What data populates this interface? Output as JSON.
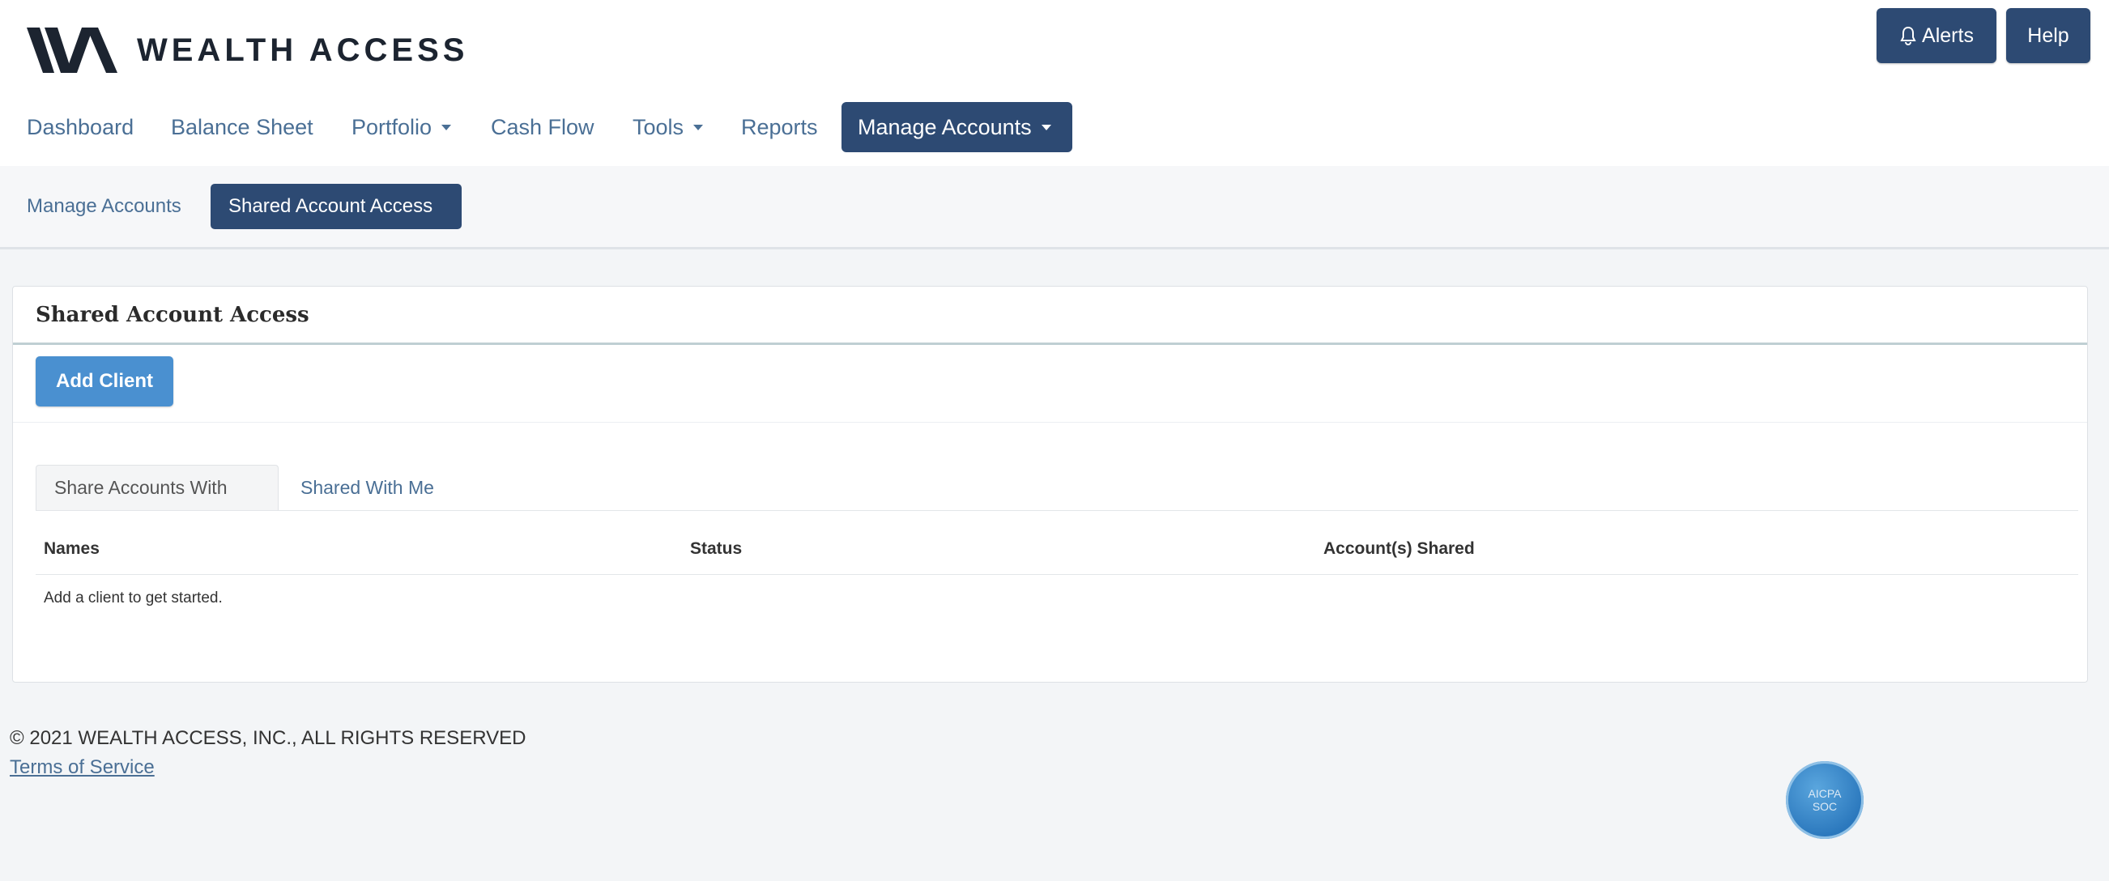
{
  "brand": {
    "name": "WEALTH ACCESS",
    "logo_icon": "wa-logo-icon"
  },
  "header_buttons": {
    "alerts_label": "Alerts",
    "alerts_icon": "bell-icon",
    "help_label": "Help"
  },
  "main_nav": {
    "items": [
      {
        "label": "Dashboard"
      },
      {
        "label": "Balance Sheet"
      },
      {
        "label": "Portfolio"
      },
      {
        "label": "Cash Flow"
      },
      {
        "label": "Tools"
      },
      {
        "label": "Reports"
      },
      {
        "label": "Manage Accounts"
      }
    ],
    "active": "Manage Accounts"
  },
  "sub_nav": {
    "items": [
      {
        "label": "Manage Accounts"
      },
      {
        "label": "Shared Account Access"
      }
    ],
    "active": "Shared Account Access"
  },
  "panel": {
    "title": "Shared Account Access",
    "add_client_label": "Add Client",
    "tabs": [
      {
        "label": "Share Accounts With"
      },
      {
        "label": "Shared With Me"
      }
    ],
    "active_tab": "Share Accounts With",
    "columns": [
      "Names",
      "Status",
      "Account(s) Shared"
    ],
    "empty_message": "Add a client to get started."
  },
  "footer": {
    "copyright": "© 2021 WEALTH ACCESS, INC., ALL RIGHTS RESERVED",
    "terms_label": "Terms of Service",
    "badge": {
      "line1": "AICPA",
      "line2": "SOC"
    }
  },
  "colors": {
    "primary_dark": "#2d4a73",
    "primary_blue": "#4a90d0",
    "link": "#4a6f95"
  }
}
